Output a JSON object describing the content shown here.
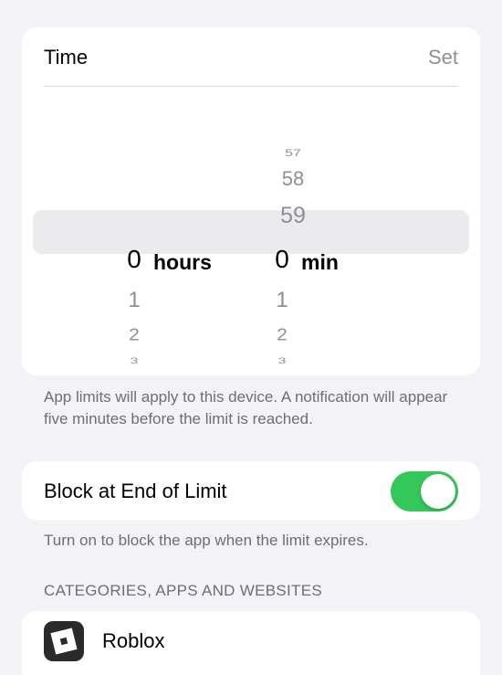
{
  "time_card": {
    "title": "Time",
    "set_label": "Set",
    "picker": {
      "hours": {
        "above": [
          "",
          ""
        ],
        "selected": "0",
        "below": [
          "1",
          "2",
          "3"
        ],
        "unit": "hours"
      },
      "minutes": {
        "above": [
          "57",
          "58",
          "59"
        ],
        "selected": "0",
        "below": [
          "1",
          "2",
          "3"
        ],
        "unit": "min"
      }
    }
  },
  "limit_note": "App limits will apply to this device. A notification will appear five minutes before the limit is reached.",
  "block": {
    "label": "Block at End of Limit",
    "enabled": true
  },
  "block_note": "Turn on to block the app when the limit expires.",
  "section_header": "CATEGORIES, APPS AND WEBSITES",
  "apps": [
    {
      "name": "Roblox",
      "icon": "roblox-logo-icon"
    }
  ],
  "colors": {
    "background": "#f2f2f7",
    "card": "#ffffff",
    "toggle_on": "#34c759",
    "secondary_text": "#8e8e93"
  }
}
